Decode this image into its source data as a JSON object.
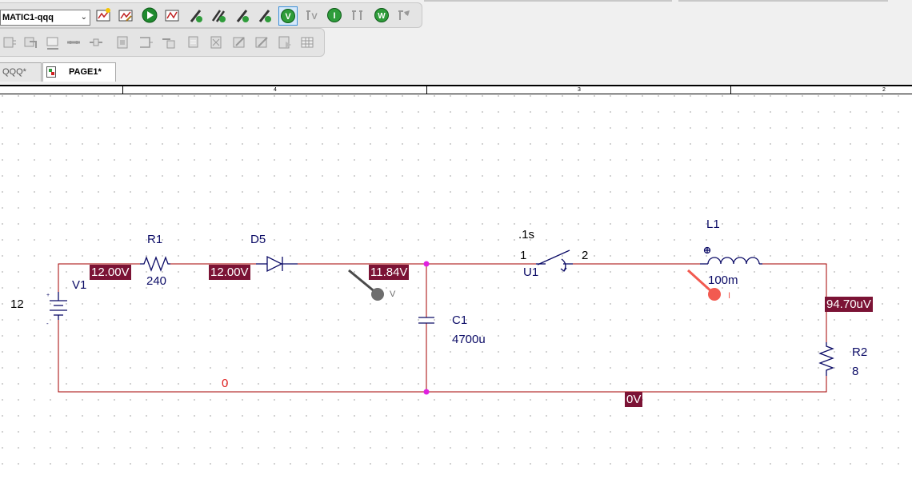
{
  "toolbar": {
    "profile_select_value": "MATIC1-qqq"
  },
  "tabs": [
    {
      "label": "QQQ*"
    },
    {
      "label": "PAGE1*"
    }
  ],
  "ruler": {
    "labels": [
      "4",
      "3",
      "2"
    ]
  },
  "components": {
    "v1": {
      "ref": "V1",
      "value": "12"
    },
    "r1": {
      "ref": "R1",
      "value": "240"
    },
    "d5": {
      "ref": "D5"
    },
    "c1": {
      "ref": "C1",
      "value": "4700u"
    },
    "u1": {
      "ref": "U1",
      "time": ".1s",
      "pin1": "1",
      "pin2": "2"
    },
    "l1": {
      "ref": "L1",
      "value": "100m"
    },
    "r2": {
      "ref": "R2",
      "value": "8"
    }
  },
  "net_labels": {
    "ground": "0"
  },
  "bias_voltages": {
    "left_top": "12.00V",
    "mid_top": "12.00V",
    "node_cap": "11.84V",
    "right": "94.70uV",
    "bottom": "0V"
  },
  "probes": {
    "voltage_letter": "V",
    "current_letter": "I"
  },
  "colors": {
    "wire": "#a40000",
    "component": "#0b0b66",
    "bias_label_bg": "#7b1335",
    "junction": "#e020e0",
    "current_probe": "#f25a50",
    "voltage_probe": "#6e6e6e"
  }
}
